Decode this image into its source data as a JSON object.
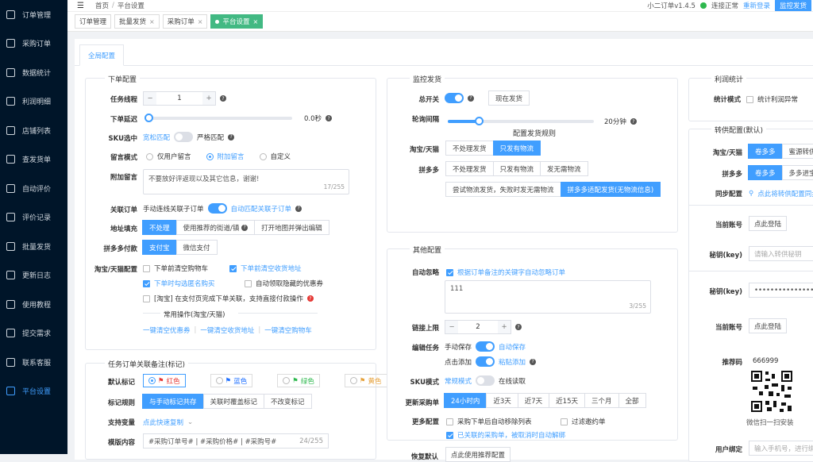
{
  "sidebar": {
    "items": [
      {
        "label": "订单管理",
        "icon": "order-icon"
      },
      {
        "label": "采购订单",
        "icon": "purchase-icon"
      },
      {
        "label": "数据统计",
        "icon": "chart-icon"
      },
      {
        "label": "利润明细",
        "icon": "bar-icon"
      },
      {
        "label": "店铺列表",
        "icon": "store-icon"
      },
      {
        "label": "查发货单",
        "icon": "truck-icon"
      },
      {
        "label": "自动评价",
        "icon": "pen-icon"
      },
      {
        "label": "评价记录",
        "icon": "record-icon"
      },
      {
        "label": "批量发货",
        "icon": "send-icon"
      },
      {
        "label": "更新日志",
        "icon": "log-icon"
      },
      {
        "label": "使用教程",
        "icon": "book-icon"
      },
      {
        "label": "提交需求",
        "icon": "mail-icon"
      },
      {
        "label": "联系客服",
        "icon": "headset-icon"
      },
      {
        "label": "平台设置",
        "icon": "gear-icon",
        "active": true
      }
    ]
  },
  "top": {
    "home": "首页",
    "sep": "/",
    "current": "平台设置",
    "version": "小二订单v1.4.5",
    "status": "连接正常",
    "refresh": "重新登录",
    "monitor": "监控发货"
  },
  "tabs": [
    {
      "label": "订单管理"
    },
    {
      "label": "批量发货"
    },
    {
      "label": "采购订单"
    },
    {
      "label": "平台设置",
      "active": true
    }
  ],
  "card_tab": "全局配置",
  "order": {
    "title": "下单配置",
    "thread_label": "任务线程",
    "thread_val": "1",
    "delay_label": "下单延迟",
    "delay_val": "0.0秒",
    "sku_label": "SKU选中",
    "sku_loose": "宽松匹配",
    "sku_strict": "严格匹配",
    "msg_label": "留言模式",
    "msg_opts": [
      "仅用户留言",
      "附加留言",
      "自定义"
    ],
    "extra_label": "附加留言",
    "extra_text": "不要放好评返现以及其它信息，谢谢!",
    "extra_count": "17/255",
    "link_label": "关联订单",
    "link_manual": "手动连线关联子订单",
    "link_auto": "自动匹配关联子订单",
    "addr_label": "地址填充",
    "addr_opts": [
      "不处理",
      "使用推荐的街道/镇",
      "打开地图并弹出编辑"
    ],
    "pdd_pay_label": "拼多多付款",
    "pdd_pay_opts": [
      "支付宝",
      "微信支付"
    ],
    "tb_label": "淘宝/天猫配置",
    "tb_opts": [
      "下单前清空购物车",
      "下单前清空收货地址",
      "下单时勾选匿名购买",
      "自动领取隐藏的优惠券",
      "[淘宝] 在支付页完成下单关联，支持直接付款操作"
    ],
    "common_title": "常用操作(淘宝/天猫)",
    "common_links": [
      "一键清空优惠券",
      "一键清空收货地址",
      "一键清空购物车"
    ]
  },
  "remark": {
    "title": "任务订单关联备注(标记)",
    "default_label": "默认标记",
    "colors": [
      "红色",
      "蓝色",
      "绿色",
      "黄色"
    ],
    "rule_label": "标记规则",
    "rules": [
      "与手动标记共存",
      "关联时覆盖标记",
      "不改变标记"
    ],
    "var_label": "支持变量",
    "var_link": "点此快速复制",
    "tpl_label": "模版内容",
    "tpl_text": "#采购订单号# | #采购价格# | #采购号#",
    "tpl_count": "24/255"
  },
  "monitor": {
    "title": "监控发货",
    "master_label": "总开关",
    "ship_now": "现在发货",
    "poll_label": "轮询间隔",
    "poll_val": "20分钟",
    "rule_title": "配置发货规则",
    "tb_label": "淘宝/天猫",
    "tb_opts": [
      "不处理发货",
      "只发有物流"
    ],
    "pdd_label": "拼多多",
    "pdd_opts": [
      "不处理发货",
      "只发有物流",
      "发无需物流"
    ],
    "pdd_opts2": [
      "尝试物流发货，失败时发无需物流",
      "拼多多适配发货(无物流信息)"
    ]
  },
  "other": {
    "title": "其他配置",
    "ignore_label": "自动忽略",
    "ignore_text": "根据订单备注的关键字自动忽略订单",
    "ignore_val": "111",
    "ignore_count": "3/255",
    "limit_label": "链接上限",
    "limit_val": "2",
    "edit_label": "编辑任务",
    "manual_save": "手动保存",
    "auto_save": "自动保存",
    "click_add": "点击添加",
    "paste_add": "粘贴添加",
    "sku_label": "SKU模式",
    "sku_normal": "常规模式",
    "sku_online": "在线读取",
    "update_label": "更新采购单",
    "update_opts": [
      "24小时内",
      "近3天",
      "近7天",
      "近15天",
      "三个月",
      "全部"
    ],
    "more_label": "更多配置",
    "more_opts": [
      "采购下单后自动移除列表",
      "过滤邀约单",
      "已关联的采购单，被取消时自动解绑"
    ],
    "reset_label": "恢复默认",
    "reset_btn": "点此使用推荐配置"
  },
  "profit": {
    "title": "利润统计",
    "mode_label": "统计模式",
    "mode_text": "统计利润异常"
  },
  "transfer": {
    "title": "转供配置(默认)",
    "tb_label": "淘宝/天猫",
    "tb_opts": [
      "卷多多",
      "蜜源转供"
    ],
    "pdd_label": "拼多多",
    "pdd_opts": [
      "卷多多",
      "多多进宝"
    ],
    "sync_label": "同步配置",
    "sync_link": "点此将转供配置同步",
    "acct_label": "当前账号",
    "login_btn": "点此登陆",
    "key_label": "秘钥(key)",
    "key_ph": "请输入转供秘钥",
    "key2_label": "秘钥(key)",
    "key2_val": "••••••••••••••••••••••",
    "acct2_label": "当前账号",
    "login2_btn": "点此登陆",
    "ref_label": "推荐码",
    "ref_val": "666999",
    "qr_caption": "微信扫一扫安装",
    "bind_label": "用户绑定",
    "bind_ph": "输入手机号，进行绑定"
  }
}
